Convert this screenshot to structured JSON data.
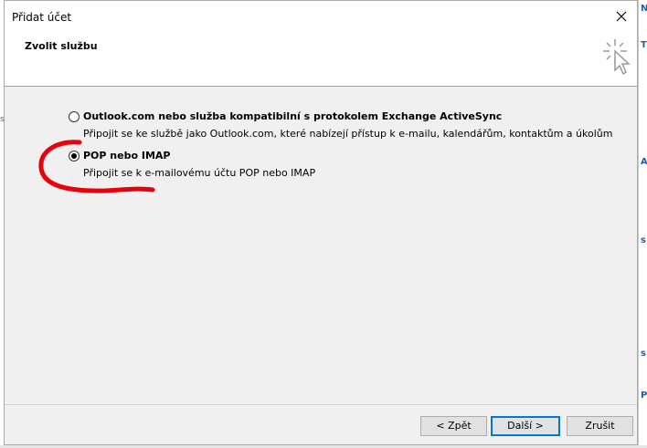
{
  "window": {
    "title": "Přidat účet"
  },
  "header": {
    "title": "Zvolit službu",
    "icon": "sparkle-cursor-icon"
  },
  "options": [
    {
      "label": "Outlook.com nebo služba kompatibilní s protokolem Exchange ActiveSync",
      "description": "Připojit se ke službě jako Outlook.com, které nabízejí přístup k e-mailu, kalendářům, kontaktům a úkolům",
      "selected": false
    },
    {
      "label": "POP nebo IMAP",
      "description": "Připojit se k e-mailovému účtu POP nebo IMAP",
      "selected": true
    }
  ],
  "buttons": {
    "back": "< Zpět",
    "next": "Další >",
    "cancel": "Zrušit"
  },
  "annotation_color": "#e8000b"
}
